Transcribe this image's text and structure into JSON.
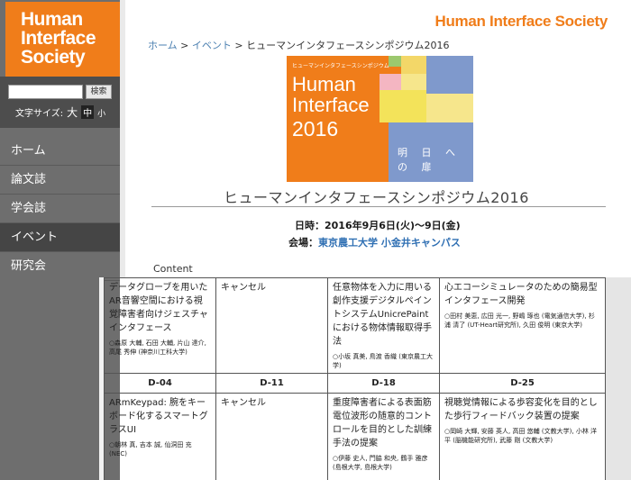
{
  "sidebar": {
    "logo_line1": "Human",
    "logo_line2": "Interface",
    "logo_line3": "Society",
    "search_placeholder": "",
    "search_button": "検索",
    "font_size_label": "文字サイズ:",
    "font_size_options": [
      "大",
      "中",
      "小"
    ],
    "nav": [
      "ホーム",
      "論文誌",
      "学会誌",
      "イベント",
      "研究会"
    ]
  },
  "header": {
    "site_name": "Human Interface Society",
    "breadcrumb": [
      "ホーム",
      "イベント",
      "ヒューマンインタフェースシンポジウム2016"
    ],
    "breadcrumb_sep": " > "
  },
  "banner": {
    "small_text": "ヒューマンインタフェースシンポジウム",
    "title_line1": "Human",
    "title_line2": "Interface",
    "year": "2016",
    "tagline": "明 日 へ の 扉"
  },
  "event": {
    "title": "ヒューマンインタフェースシンポジウム2016",
    "date_label": "日時：",
    "date_value": "2016年9月6日(火)～9日(金)",
    "venue_label": "会場：",
    "venue_value": "東京農工大学 小金井キャンパス",
    "content_label": "Content"
  },
  "table": {
    "row1": [
      {
        "title": "データグローブを用いたAR音響空間における視覚障害者向けジェスチャインタフェース",
        "authors": "○森原 大輔, 石田 大輔, 片山 達介, 高尾 秀伸 (神奈川工科大学)"
      },
      {
        "title": "キャンセル",
        "authors": ""
      },
      {
        "title": "任意物体を入力に用いる創作支援デジタルペイントシステムUnicrePaintにおける物体情報取得手法",
        "authors": "○小坂 真美, 鳥渡 香織 (東京農工大学)"
      },
      {
        "title": "心エコーシミュレータのための簡易型インタフェース開発",
        "authors": "○田村 美恵, 広田 光一, 野嶋 琢也 (電気通信大学), 杉浦 清了 (UT-Heart研究所), 久田 俊明 (東京大学)"
      }
    ],
    "codes": [
      "D-04",
      "D-11",
      "D-18",
      "D-25"
    ],
    "row2": [
      {
        "title": "ARmKeypad: 腕をキーボード化するスマートグラスUI",
        "authors": "○朝林 真, 吉本 誠, 仙洞田 充 (NEC)"
      },
      {
        "title": "キャンセル",
        "authors": ""
      },
      {
        "title": "重度障害者による表面筋電位波形の随意的コントロールを目的とした訓練手法の提案",
        "authors": "○伊藤 史人, 門脇 和央, 鶴手 雅彦 (島根大学, 島根大学)"
      },
      {
        "title": "視聴覚情報による歩容変化を目的とした歩行フィードバック装置の提案",
        "authors": "○岡崎 大輝, 安藤 英人, 高田 悠輔 (文教大学), 小林 洋平 (脳機能研究所), 武藤 剛 (文教大学)"
      }
    ]
  },
  "colors": {
    "brand_orange": "#f07d1a",
    "sidebar_gray": "#6e6e6e",
    "link_blue": "#2f6fb3"
  }
}
